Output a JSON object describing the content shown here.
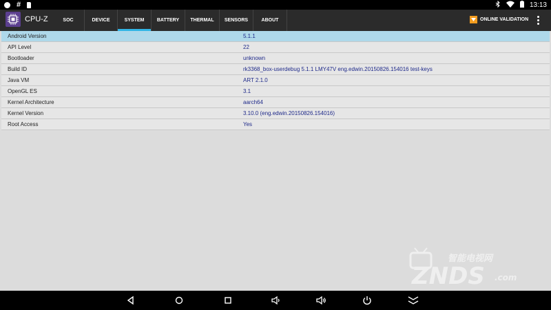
{
  "status_bar": {
    "time": "13:13",
    "left_icons": [
      "notification-dot-icon",
      "hash-icon",
      "sdcard-icon"
    ],
    "right_icons": [
      "bluetooth-icon",
      "wifi-icon",
      "battery-icon"
    ]
  },
  "app": {
    "title": "CPU-Z",
    "logo_icon": "cpu-chip-icon",
    "accent_color": "#33b5e5",
    "logo_color": "#5b3f8f"
  },
  "tabs": [
    {
      "label": "SOC",
      "active": false
    },
    {
      "label": "DEVICE",
      "active": false
    },
    {
      "label": "SYSTEM",
      "active": true
    },
    {
      "label": "BATTERY",
      "active": false
    },
    {
      "label": "THERMAL",
      "active": false
    },
    {
      "label": "SENSORS",
      "active": false
    },
    {
      "label": "ABOUT",
      "active": false
    }
  ],
  "actions": {
    "online_validation": "ONLINE VALIDATION",
    "online_icon": "validation-icon",
    "online_icon_color": "#f39c1f",
    "overflow_icon": "more-vertical-icon"
  },
  "rows": [
    {
      "label": "Android Version",
      "value": "5.1.1",
      "selected": true
    },
    {
      "label": "API Level",
      "value": "22"
    },
    {
      "label": "Bootloader",
      "value": "unknown"
    },
    {
      "label": "Build ID",
      "value": "rk3368_box-userdebug 5.1.1 LMY47V eng.edwin.20150826.154016 test-keys"
    },
    {
      "label": "Java VM",
      "value": "ART 2.1.0"
    },
    {
      "label": "OpenGL ES",
      "value": "3.1"
    },
    {
      "label": "Kernel Architecture",
      "value": "aarch64"
    },
    {
      "label": "Kernel Version",
      "value": "3.10.0 (eng.edwin.20150826.154016)"
    },
    {
      "label": "Root Access",
      "value": "Yes"
    }
  ],
  "watermark": {
    "text": "ZNDS",
    "suffix": ".com",
    "subtitle": "智能电视网"
  },
  "nav_bar": [
    "back-icon",
    "home-icon",
    "recents-icon",
    "volume-down-icon",
    "volume-up-icon",
    "power-icon",
    "hide-nav-icon"
  ]
}
